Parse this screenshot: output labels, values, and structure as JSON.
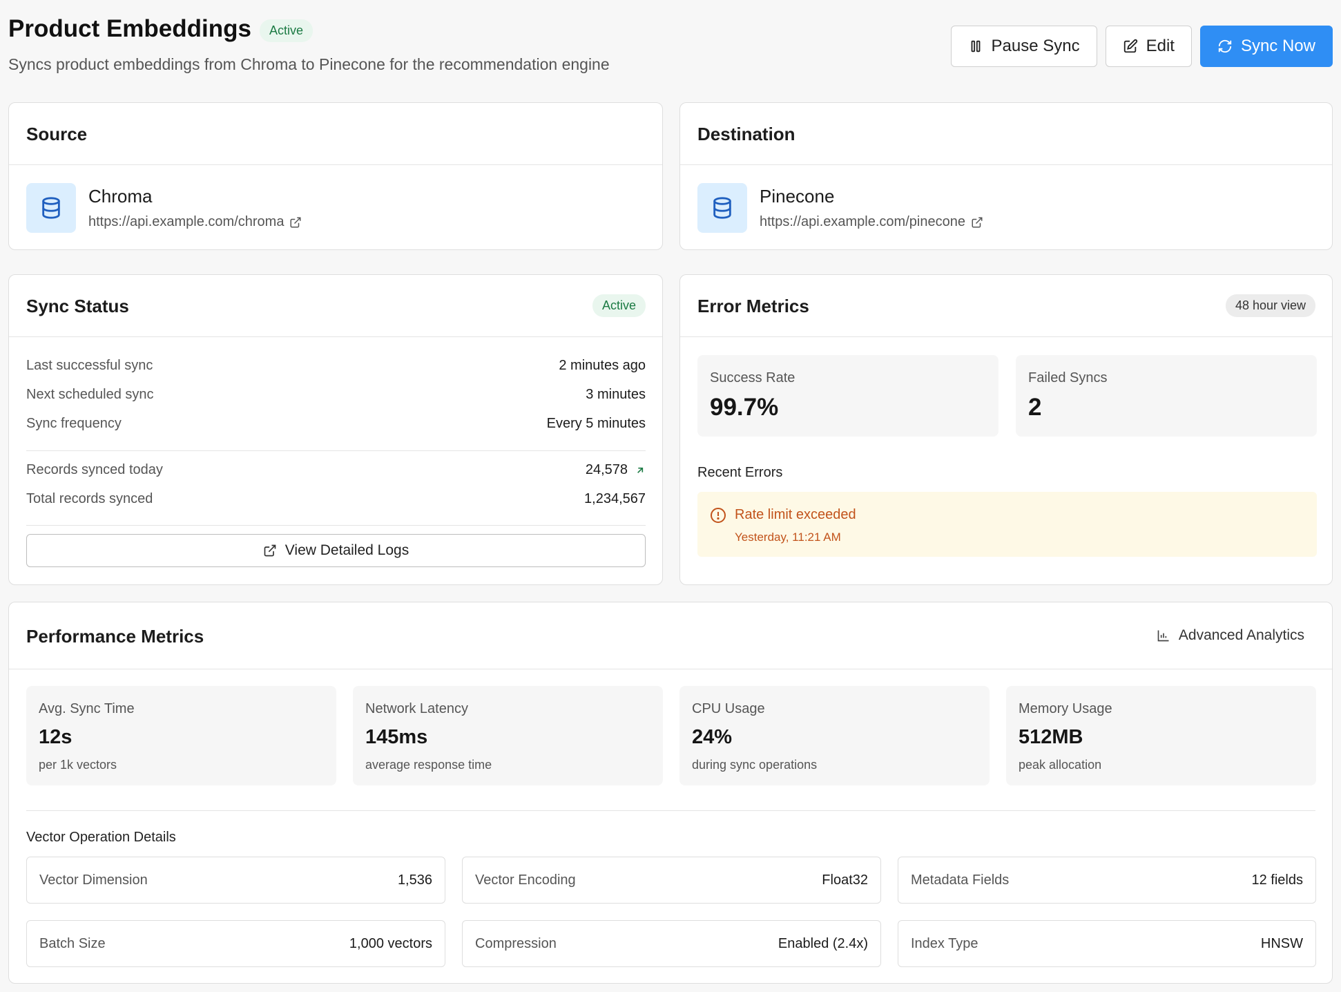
{
  "header": {
    "title": "Product Embeddings",
    "status": "Active",
    "subtitle": "Syncs product embeddings from Chroma to Pinecone for the recommendation engine",
    "pause_label": "Pause Sync",
    "edit_label": "Edit",
    "sync_label": "Sync Now"
  },
  "source": {
    "heading": "Source",
    "name": "Chroma",
    "url": "https://api.example.com/chroma"
  },
  "destination": {
    "heading": "Destination",
    "name": "Pinecone",
    "url": "https://api.example.com/pinecone"
  },
  "sync_status": {
    "heading": "Sync Status",
    "badge": "Active",
    "rows": [
      {
        "label": "Last successful sync",
        "value": "2 minutes ago"
      },
      {
        "label": "Next scheduled sync",
        "value": "3 minutes"
      },
      {
        "label": "Sync frequency",
        "value": "Every 5 minutes"
      }
    ],
    "records_today_label": "Records synced today",
    "records_today_value": "24,578",
    "total_label": "Total records synced",
    "total_value": "1,234,567",
    "logs_button": "View Detailed Logs"
  },
  "error_metrics": {
    "heading": "Error Metrics",
    "badge": "48 hour view",
    "success_label": "Success Rate",
    "success_value": "99.7%",
    "failed_label": "Failed Syncs",
    "failed_value": "2",
    "recent_label": "Recent Errors",
    "recent": [
      {
        "title": "Rate limit exceeded",
        "time": "Yesterday, 11:21 AM"
      }
    ]
  },
  "performance": {
    "heading": "Performance Metrics",
    "analytics_link": "Advanced Analytics",
    "metrics": [
      {
        "label": "Avg. Sync Time",
        "value": "12s",
        "sub": "per 1k vectors"
      },
      {
        "label": "Network Latency",
        "value": "145ms",
        "sub": "average response time"
      },
      {
        "label": "CPU Usage",
        "value": "24%",
        "sub": "during sync operations"
      },
      {
        "label": "Memory Usage",
        "value": "512MB",
        "sub": "peak allocation"
      }
    ],
    "vector_heading": "Vector Operation Details",
    "details": [
      {
        "label": "Vector Dimension",
        "value": "1,536"
      },
      {
        "label": "Vector Encoding",
        "value": "Float32"
      },
      {
        "label": "Metadata Fields",
        "value": "12 fields"
      },
      {
        "label": "Batch Size",
        "value": "1,000 vectors"
      },
      {
        "label": "Compression",
        "value": "Enabled (2.4x)"
      },
      {
        "label": "Index Type",
        "value": "HNSW"
      }
    ]
  },
  "colors": {
    "accent": "#2f8ef4",
    "success_badge_bg": "#e9f6ee",
    "success_badge_text": "#1b7a43",
    "error_bg": "#fef9e6",
    "error_text": "#c2531b"
  },
  "icons": {
    "pause": "pause-icon",
    "edit": "edit-icon",
    "sync": "refresh-icon",
    "database": "database-icon",
    "external": "external-link-icon",
    "trend": "arrow-up-right-icon",
    "chart": "bar-chart-icon",
    "alert": "alert-circle-icon"
  }
}
